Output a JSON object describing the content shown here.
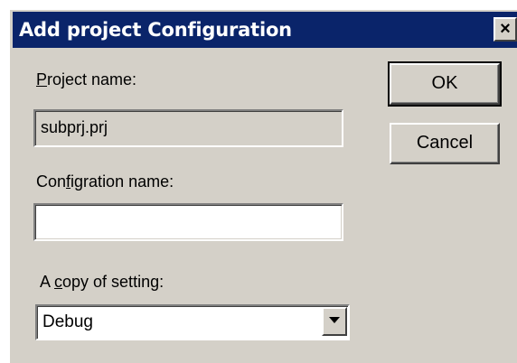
{
  "window": {
    "title": "Add project Configuration",
    "close_glyph": "×"
  },
  "form": {
    "project_name_label_pre": "",
    "project_name_label_key": "P",
    "project_name_label_post": "roject name:",
    "project_name_value": "subprj.prj",
    "config_name_label_pre": "Con",
    "config_name_label_key": "f",
    "config_name_label_post": "igration name:",
    "config_name_value": "",
    "copy_label_pre": "A ",
    "copy_label_key": "c",
    "copy_label_post": "opy of setting:",
    "copy_selected": "Debug"
  },
  "buttons": {
    "ok": "OK",
    "cancel": "Cancel"
  },
  "icons": {
    "close": "close-icon",
    "dropdown": "chevron-down-icon"
  },
  "colors": {
    "titlebar": "#0a246a",
    "dialog_face": "#d4d0c8"
  }
}
